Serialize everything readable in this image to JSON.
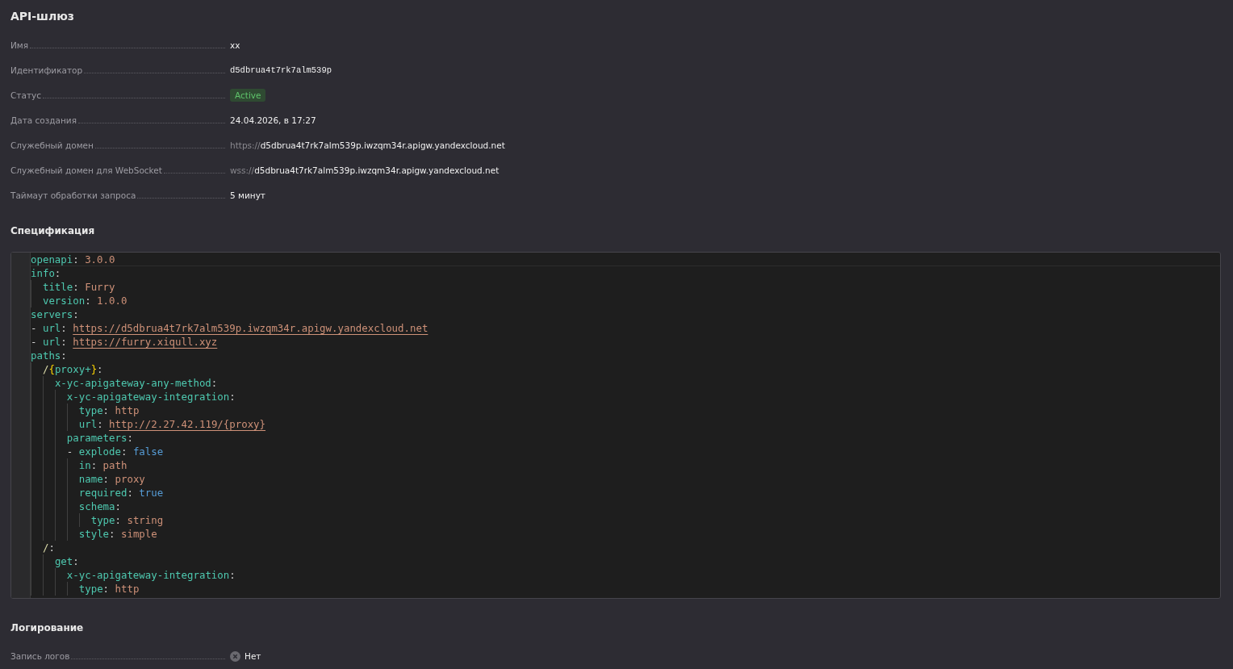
{
  "title": "API-шлюз",
  "details": [
    {
      "label": "Имя",
      "kind": "text",
      "value": "xx"
    },
    {
      "label": "Идентификатор",
      "kind": "mono",
      "value": "d5dbrua4t7rk7alm539p"
    },
    {
      "label": "Статус",
      "kind": "badge",
      "value": "Active"
    },
    {
      "label": "Дата создания",
      "kind": "text",
      "value": "24.04.2026, в 17:27"
    },
    {
      "label": "Служебный домен",
      "kind": "url",
      "scheme": "https://",
      "value": "d5dbrua4t7rk7alm539p.iwzqm34r.apigw.yandexcloud.net"
    },
    {
      "label": "Служебный домен для WebSocket",
      "kind": "url",
      "scheme": "wss://",
      "value": "d5dbrua4t7rk7alm539p.iwzqm34r.apigw.yandexcloud.net"
    },
    {
      "label": "Таймаут обработки запроса",
      "kind": "text",
      "value": "5 минут"
    }
  ],
  "spec": {
    "title": "Спецификация",
    "lines": [
      {
        "tokens": [
          {
            "kind": "key",
            "text": "openapi"
          },
          {
            "kind": "punct",
            "text": ": "
          },
          {
            "kind": "string",
            "text": "3.0.0"
          }
        ]
      },
      {
        "tokens": [
          {
            "kind": "key",
            "text": "info"
          },
          {
            "kind": "punct",
            "text": ":"
          }
        ],
        "children": [
          {
            "tokens": [
              {
                "kind": "key",
                "text": "title"
              },
              {
                "kind": "punct",
                "text": ": "
              },
              {
                "kind": "string",
                "text": "Furry"
              }
            ]
          },
          {
            "tokens": [
              {
                "kind": "key",
                "text": "version"
              },
              {
                "kind": "punct",
                "text": ": "
              },
              {
                "kind": "string",
                "text": "1.0.0"
              }
            ]
          }
        ]
      },
      {
        "tokens": [
          {
            "kind": "key",
            "text": "servers"
          },
          {
            "kind": "punct",
            "text": ":"
          }
        ],
        "children": [
          {
            "tokens": [
              {
                "kind": "dash",
                "text": "- "
              },
              {
                "kind": "key",
                "text": "url"
              },
              {
                "kind": "punct",
                "text": ": "
              },
              {
                "kind": "link",
                "text": "https://d5dbrua4t7rk7alm539p.iwzqm34r.apigw.yandexcloud.net"
              }
            ]
          },
          {
            "tokens": [
              {
                "kind": "dash",
                "text": "- "
              },
              {
                "kind": "key",
                "text": "url"
              },
              {
                "kind": "punct",
                "text": ": "
              },
              {
                "kind": "link",
                "text": "https://furry.xiqull.xyz"
              }
            ]
          }
        ]
      },
      {
        "tokens": [
          {
            "kind": "key",
            "text": "paths"
          },
          {
            "kind": "punct",
            "text": ":"
          }
        ],
        "children": [
          {
            "tokens": [
              {
                "kind": "path",
                "text": "/"
              },
              {
                "kind": "brace",
                "text": "{"
              },
              {
                "kind": "key",
                "text": "proxy+"
              },
              {
                "kind": "brace",
                "text": "}"
              },
              {
                "kind": "punct",
                "text": ":"
              }
            ],
            "children": [
              {
                "tokens": [
                  {
                    "kind": "key",
                    "text": "x-yc-apigateway-any-method"
                  },
                  {
                    "kind": "punct",
                    "text": ":"
                  }
                ],
                "children": [
                  {
                    "tokens": [
                      {
                        "kind": "key",
                        "text": "x-yc-apigateway-integration"
                      },
                      {
                        "kind": "punct",
                        "text": ":"
                      }
                    ],
                    "children": [
                      {
                        "tokens": [
                          {
                            "kind": "key",
                            "text": "type"
                          },
                          {
                            "kind": "punct",
                            "text": ": "
                          },
                          {
                            "kind": "string",
                            "text": "http"
                          }
                        ]
                      },
                      {
                        "tokens": [
                          {
                            "kind": "key",
                            "text": "url"
                          },
                          {
                            "kind": "punct",
                            "text": ": "
                          },
                          {
                            "kind": "link",
                            "text": "http://2.27.42.119/{proxy}"
                          }
                        ]
                      }
                    ]
                  },
                  {
                    "tokens": [
                      {
                        "kind": "key",
                        "text": "parameters"
                      },
                      {
                        "kind": "punct",
                        "text": ":"
                      }
                    ],
                    "children": [
                      {
                        "tokens": [
                          {
                            "kind": "dash",
                            "text": "- "
                          },
                          {
                            "kind": "key",
                            "text": "explode"
                          },
                          {
                            "kind": "punct",
                            "text": ": "
                          },
                          {
                            "kind": "bool",
                            "text": "false"
                          }
                        ],
                        "children": [
                          {
                            "tokens": [
                              {
                                "kind": "key",
                                "text": "in"
                              },
                              {
                                "kind": "punct",
                                "text": ": "
                              },
                              {
                                "kind": "string",
                                "text": "path"
                              }
                            ]
                          },
                          {
                            "tokens": [
                              {
                                "kind": "key",
                                "text": "name"
                              },
                              {
                                "kind": "punct",
                                "text": ": "
                              },
                              {
                                "kind": "string",
                                "text": "proxy"
                              }
                            ]
                          },
                          {
                            "tokens": [
                              {
                                "kind": "key",
                                "text": "required"
                              },
                              {
                                "kind": "punct",
                                "text": ": "
                              },
                              {
                                "kind": "bool",
                                "text": "true"
                              }
                            ]
                          },
                          {
                            "tokens": [
                              {
                                "kind": "key",
                                "text": "schema"
                              },
                              {
                                "kind": "punct",
                                "text": ":"
                              }
                            ],
                            "children": [
                              {
                                "tokens": [
                                  {
                                    "kind": "key",
                                    "text": "type"
                                  },
                                  {
                                    "kind": "punct",
                                    "text": ": "
                                  },
                                  {
                                    "kind": "string",
                                    "text": "string"
                                  }
                                ]
                              }
                            ]
                          },
                          {
                            "tokens": [
                              {
                                "kind": "key",
                                "text": "style"
                              },
                              {
                                "kind": "punct",
                                "text": ": "
                              },
                              {
                                "kind": "string",
                                "text": "simple"
                              }
                            ]
                          }
                        ]
                      }
                    ]
                  }
                ]
              }
            ]
          },
          {
            "tokens": [
              {
                "kind": "path",
                "text": "/"
              },
              {
                "kind": "punct",
                "text": ":"
              }
            ],
            "children": [
              {
                "tokens": [
                  {
                    "kind": "key",
                    "text": "get"
                  },
                  {
                    "kind": "punct",
                    "text": ":"
                  }
                ],
                "children": [
                  {
                    "tokens": [
                      {
                        "kind": "key",
                        "text": "x-yc-apigateway-integration"
                      },
                      {
                        "kind": "punct",
                        "text": ":"
                      }
                    ],
                    "children": [
                      {
                        "tokens": [
                          {
                            "kind": "key",
                            "text": "type"
                          },
                          {
                            "kind": "punct",
                            "text": ": "
                          },
                          {
                            "kind": "string",
                            "text": "http"
                          }
                        ]
                      }
                    ]
                  }
                ]
              }
            ]
          }
        ]
      }
    ]
  },
  "logging": {
    "title": "Логирование",
    "rows": [
      {
        "label": "Запись логов",
        "kind": "off",
        "value": "Нет"
      }
    ]
  }
}
